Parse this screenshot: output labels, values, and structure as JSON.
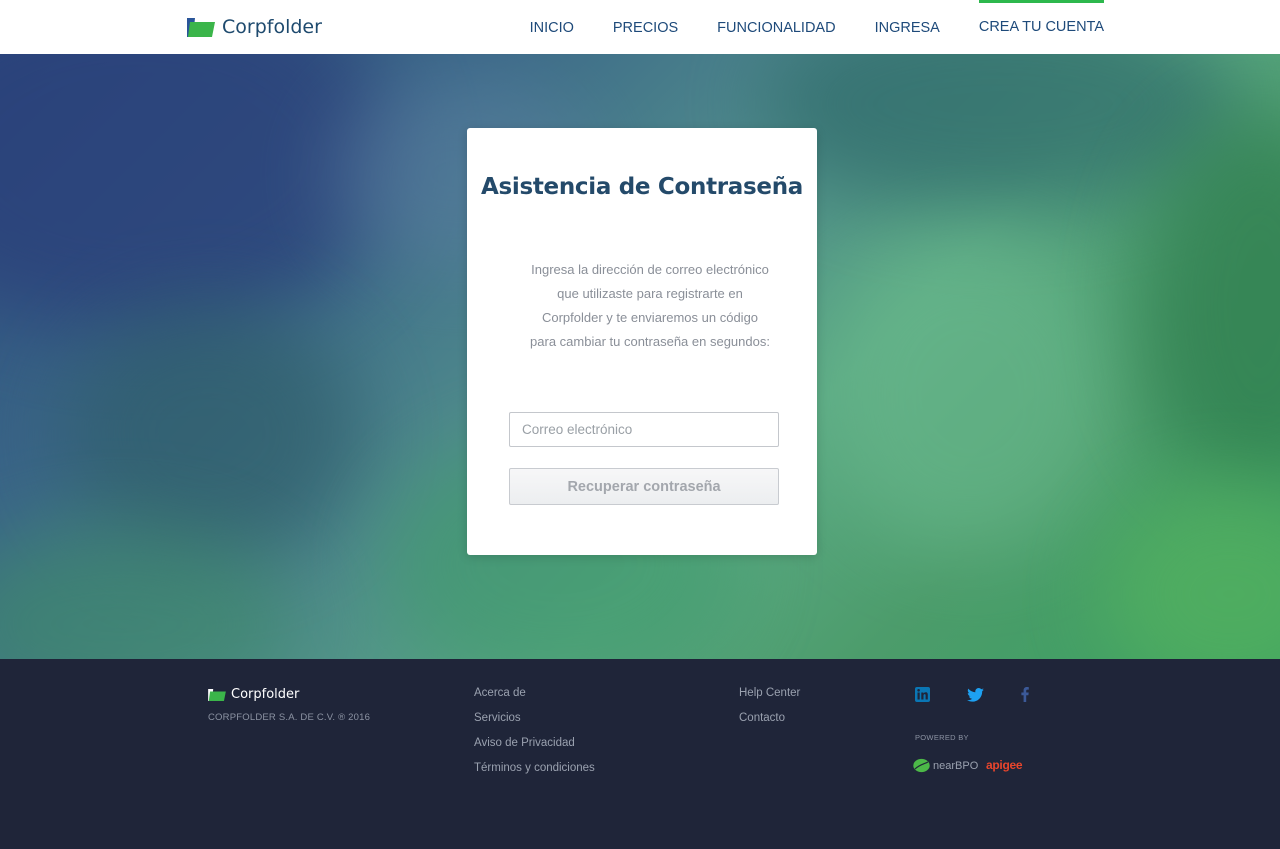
{
  "header": {
    "brand": "Corpfolder",
    "nav": [
      {
        "label": "INICIO"
      },
      {
        "label": "PRECIOS"
      },
      {
        "label": "FUNCIONALIDAD"
      },
      {
        "label": "INGRESA"
      },
      {
        "label": "CREA TU CUENTA",
        "active": true
      }
    ]
  },
  "card": {
    "title": "Asistencia de Contraseña",
    "description_lines": [
      "Ingresa la dirección de correo electrónico",
      "que utilizaste para registrarte en",
      "Corpfolder y te enviaremos un código",
      "para cambiar tu contraseña en segundos:"
    ],
    "email_placeholder": "Correo electrónico",
    "email_value": "",
    "submit_label": "Recuperar contraseña"
  },
  "footer": {
    "brand": "Corpfolder",
    "copyright": "CORPFOLDER S.A. DE C.V. ® 2016",
    "col1": [
      "Acerca de",
      "Servicios",
      "Aviso de Privacidad",
      "Términos y condiciones"
    ],
    "col2": [
      "Help Center",
      "Contacto"
    ],
    "social_icons": [
      "linkedin-icon",
      "twitter-icon",
      "facebook-icon"
    ],
    "powered_by": "POWERED BY",
    "partners": {
      "nearbpo": "nearBPO",
      "apigee": "apigee"
    }
  },
  "colors": {
    "accent_green": "#2db84d",
    "nav_text": "#1e4a7a",
    "footer_bg": "#1f2539",
    "linkedin": "#0a76b4",
    "twitter": "#1da1f2",
    "facebook": "#3b5998",
    "apigee": "#e8452c"
  }
}
